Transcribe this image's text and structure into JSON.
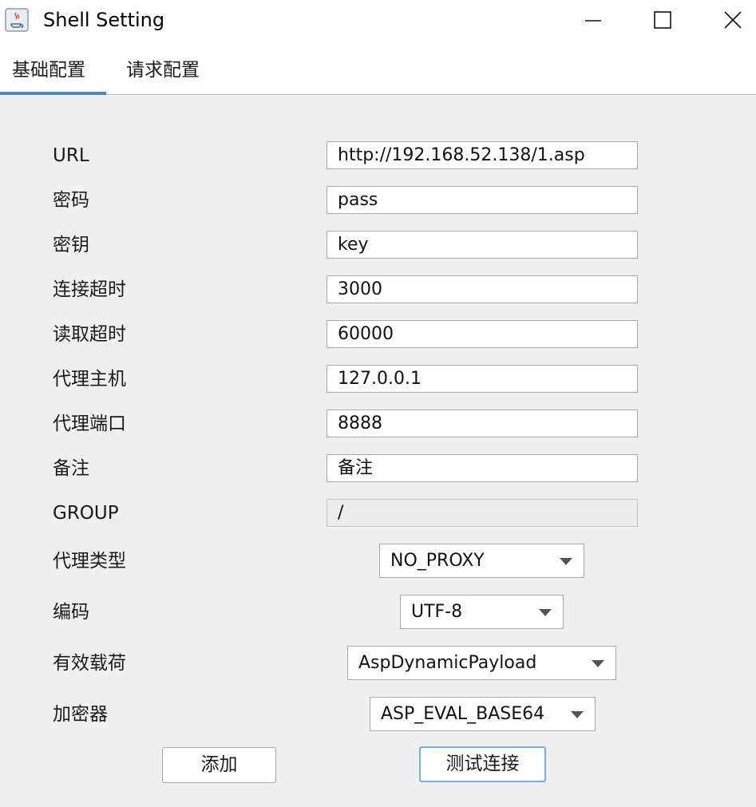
{
  "window": {
    "title": "Shell Setting",
    "icon": "java-coffee-icon",
    "controls": [
      "minimize-icon",
      "maximize-icon",
      "close-icon"
    ]
  },
  "tabs": [
    {
      "label": "基础配置",
      "active": true
    },
    {
      "label": "请求配置",
      "active": false
    }
  ],
  "form": {
    "url": {
      "label": "URL",
      "value": "http://192.168.52.138/1.asp"
    },
    "password": {
      "label": "密码",
      "value": "pass"
    },
    "key": {
      "label": "密钥",
      "value": "key"
    },
    "conn_timeout": {
      "label": "连接超时",
      "value": "3000"
    },
    "read_timeout": {
      "label": "读取超时",
      "value": "60000"
    },
    "proxy_host": {
      "label": "代理主机",
      "value": "127.0.0.1"
    },
    "proxy_port": {
      "label": "代理端口",
      "value": "8888"
    },
    "remark": {
      "label": "备注",
      "value": "备注"
    },
    "group": {
      "label": "GROUP",
      "value": "/"
    },
    "proxy_type": {
      "label": "代理类型",
      "value": "NO_PROXY"
    },
    "encoding": {
      "label": "编码",
      "value": "UTF-8"
    },
    "payload": {
      "label": "有效载荷",
      "value": "AspDynamicPayload"
    },
    "cryption": {
      "label": "加密器",
      "value": "ASP_EVAL_BASE64"
    }
  },
  "buttons": {
    "add": "添加",
    "test": "测试连接"
  },
  "colors": {
    "accent": "#4c87c8",
    "focus_border": "#78aee5",
    "background": "#f0f0f0"
  }
}
